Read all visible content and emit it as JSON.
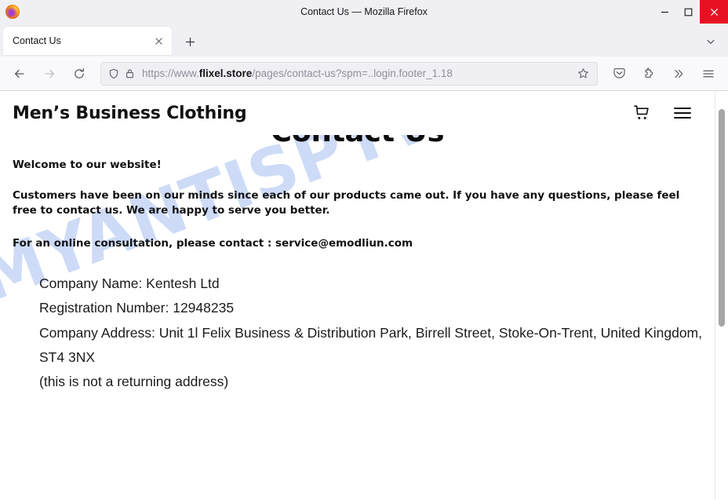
{
  "browser": {
    "window_title": "Contact Us — Mozilla Firefox",
    "logo_icon": "firefox-logo",
    "window_controls": {
      "minimize_icon": "minimize-icon",
      "maximize_icon": "maximize-icon",
      "close_icon": "close-icon"
    },
    "tabs": [
      {
        "title": "Contact Us",
        "close_icon": "close-icon",
        "active": true
      }
    ],
    "new_tab_icon": "plus-icon",
    "tab_list_icon": "chevron-down-icon",
    "nav": {
      "back_icon": "arrow-left-icon",
      "forward_icon": "arrow-right-icon",
      "reload_icon": "reload-icon"
    },
    "urlbar": {
      "shield_icon": "shield-icon",
      "lock_icon": "padlock-icon",
      "url_prefix": "https://www.",
      "url_domain": "flixel.store",
      "url_suffix": "/pages/contact-us?spm=..login.footer_1.18",
      "bookmark_icon": "star-icon"
    },
    "toolbar_right": {
      "pocket_icon": "pocket-icon",
      "extensions_icon": "extensions-puzzle-icon",
      "overflow_icon": "double-chevron-right-icon",
      "menu_icon": "hamburger-menu-icon"
    }
  },
  "page": {
    "watermark": "MYANTISPYWARE.COM",
    "site_logo": "Men’s Business Clothing",
    "cart_icon": "shopping-cart-icon",
    "menu_icon": "hamburger-menu-icon",
    "heading": "Contact Us",
    "intro": {
      "line1": "Welcome to our website!",
      "line2": "Customers have been on our minds since each of our products came out. If you have any questions, please feel free to contact us. We are happy to serve you better.",
      "line3": "For an online consultation, please contact : service@emodliun.com"
    },
    "details": {
      "company_name": "Company Name: Kentesh Ltd",
      "registration_number": "Registration Number: 12948235",
      "company_address": "Company Address: Unit 1l Felix Business & Distribution Park, Birrell Street, Stoke-On-Trent, United Kingdom, ST4 3NX",
      "note": "(this is not a returning address)"
    }
  },
  "colors": {
    "close_button": "#e81123",
    "watermark": "#c9d8f7",
    "chrome_bg": "#f0f0f4",
    "toolbar_bg": "#f9f9fb"
  }
}
